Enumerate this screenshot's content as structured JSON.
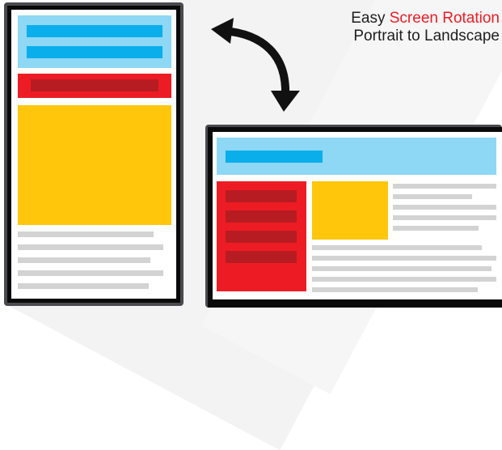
{
  "caption": {
    "line1_prefix": "Easy ",
    "line1_highlight": "Screen Rotation",
    "line2": "Portrait to Landscape"
  },
  "colors": {
    "header_light_blue": "#8ed7f5",
    "bar_blue": "#0aaeeb",
    "block_red": "#ed1c24",
    "bar_dark_red": "#b71c22",
    "block_yellow": "#ffc60b",
    "text_placeholder_gray": "#d3d3d3",
    "accent_text": "#ed1c24",
    "arrow": "#111111"
  },
  "icons": {
    "rotation_arrow": "curved-double-arrow-icon"
  }
}
